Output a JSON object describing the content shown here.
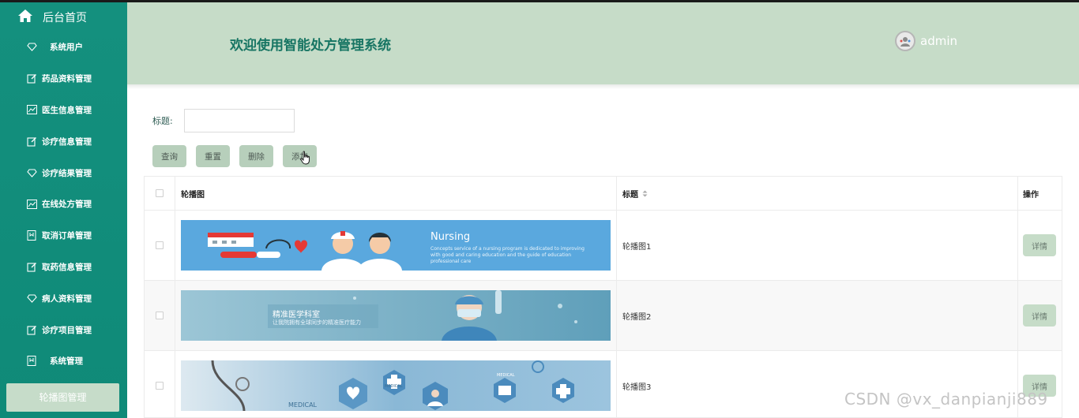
{
  "sidebar": {
    "home_label": "后台首页",
    "items": [
      {
        "label": "系统用户",
        "icon": "diamond-icon"
      },
      {
        "label": "药品资料管理",
        "icon": "edit-icon"
      },
      {
        "label": "医生信息管理",
        "icon": "chart-icon"
      },
      {
        "label": "诊疗信息管理",
        "icon": "edit-icon"
      },
      {
        "label": "诊疗结果管理",
        "icon": "diamond-icon"
      },
      {
        "label": "在线处方管理",
        "icon": "chart-icon"
      },
      {
        "label": "取消订单管理",
        "icon": "bookmark-icon"
      },
      {
        "label": "取药信息管理",
        "icon": "edit-icon"
      },
      {
        "label": "病人资料管理",
        "icon": "diamond-icon"
      },
      {
        "label": "诊疗项目管理",
        "icon": "edit-icon"
      },
      {
        "label": "系统管理",
        "icon": "bookmark-icon"
      }
    ],
    "active_sub_item": "轮播图管理"
  },
  "header": {
    "title": "欢迎使用智能处方管理系统",
    "user": "admin"
  },
  "search": {
    "label": "标题:",
    "value": ""
  },
  "toolbar": {
    "query": "查询",
    "reset": "重置",
    "delete": "删除",
    "add": "添加"
  },
  "table": {
    "columns": [
      "轮播图",
      "标题",
      "操作"
    ],
    "rows": [
      {
        "title": "轮播图1",
        "action": "详情",
        "banner_text": "Nursing",
        "banner_subtext_1": "Concepts service of a nursing program is dedicated to improving",
        "banner_subtext_2": "with good and caring education and the guide of education",
        "banner_subtext_3": "professional care"
      },
      {
        "title": "轮播图2",
        "action": "详情",
        "banner_text": "精准医学科室",
        "banner_subtext_1": "让我院拥有全球同步的精准医疗能力"
      },
      {
        "title": "轮播图3",
        "action": "详情",
        "banner_text": "MEDICAL",
        "banner_subtext_1": "MEDICAL",
        "banner_subtext_2": "MEDICAL"
      }
    ]
  },
  "watermark": "CSDN @vx_danpianji889",
  "colors": {
    "sidebar": "#13907d",
    "header": "#c6dcc8",
    "button": "#b7cfbb",
    "title": "#177563"
  }
}
